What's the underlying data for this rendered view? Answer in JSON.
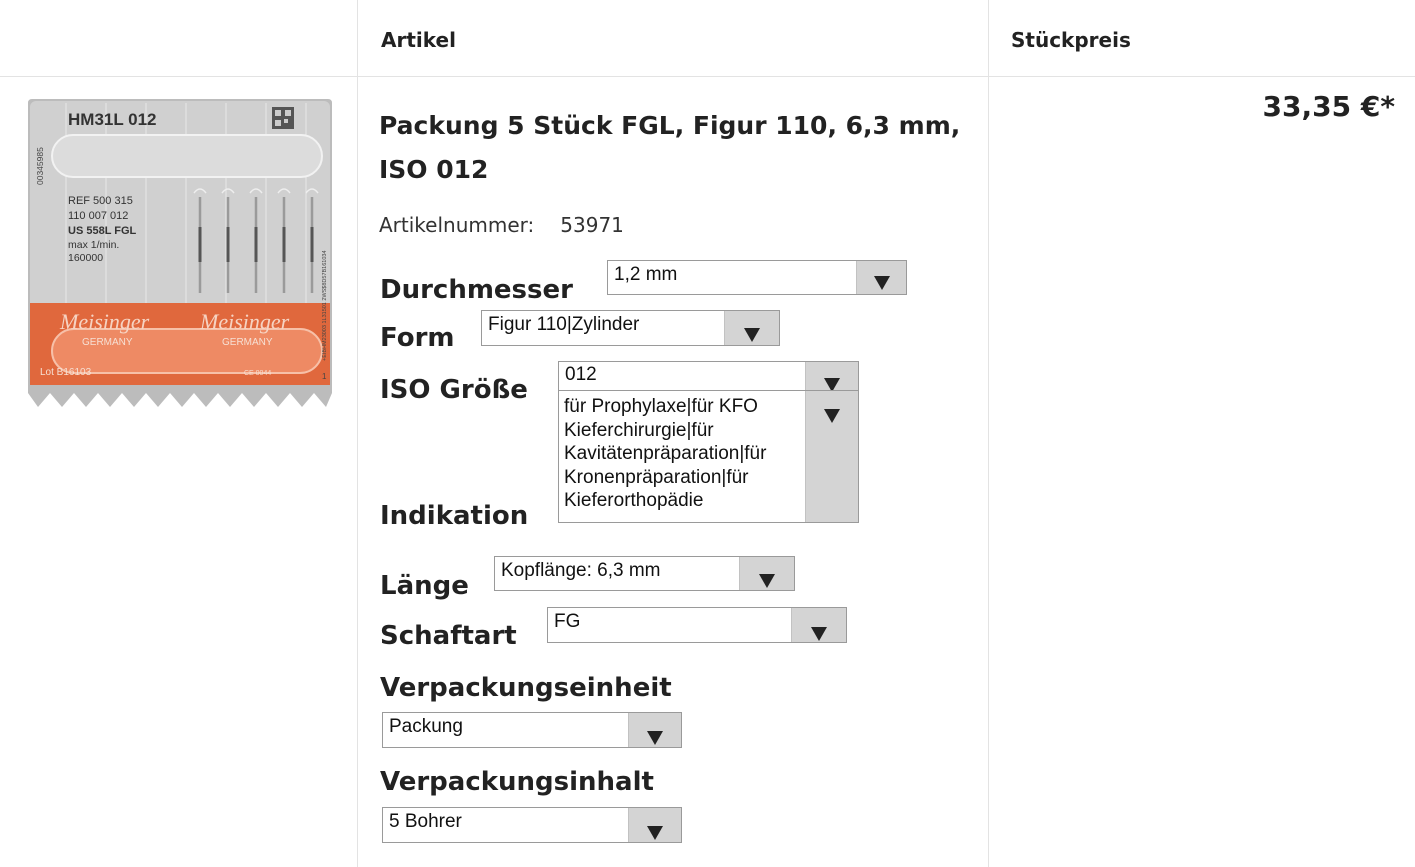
{
  "header": {
    "col_article": "Artikel",
    "col_price": "Stückpreis"
  },
  "product": {
    "title": "Packung 5 Stück FGL, Figur 110, 6,3 mm, ISO 012",
    "article_number_label": "Artikelnummer:",
    "article_number": "53971",
    "price": "33,35 €*",
    "image": {
      "code": "HM31L   012",
      "ref_lines": [
        "REF 500 315",
        "110 007 012",
        "US 558L   FGL",
        "max 1/min.",
        "160000"
      ],
      "side_left": "00345985",
      "side_right": "+EIBHM23003 1L31501 2WS$8D57B161034",
      "brand": "Meisinger",
      "country": "GERMANY",
      "lot": "Lot  B16103",
      "ce": "CE 0044",
      "count": "1"
    }
  },
  "options": {
    "durchmesser": {
      "label": "Durchmesser",
      "value": "1,2 mm"
    },
    "form": {
      "label": "Form",
      "value": "Figur 110|Zylinder"
    },
    "iso": {
      "label": "ISO Größe",
      "value": "012"
    },
    "indikation": {
      "label": "Indikation",
      "lines": [
        "für Prophylaxe|für KFO",
        "Kieferchirurgie|für",
        "Kavitätenpräparation|für",
        "Kronenpräparation|für",
        "Kieferorthopädie"
      ]
    },
    "laenge": {
      "label": "Länge",
      "value": "Kopflänge: 6,3 mm"
    },
    "schaftart": {
      "label": "Schaftart",
      "value": "FG"
    },
    "verpackungseinheit": {
      "label": "Verpackungseinheit",
      "value": "Packung"
    },
    "verpackungsinhalt": {
      "label": "Verpackungsinhalt",
      "value": "5 Bohrer"
    }
  },
  "colors": {
    "brand_orange": "#e0683d",
    "blister_grey": "#c9c9c9"
  }
}
